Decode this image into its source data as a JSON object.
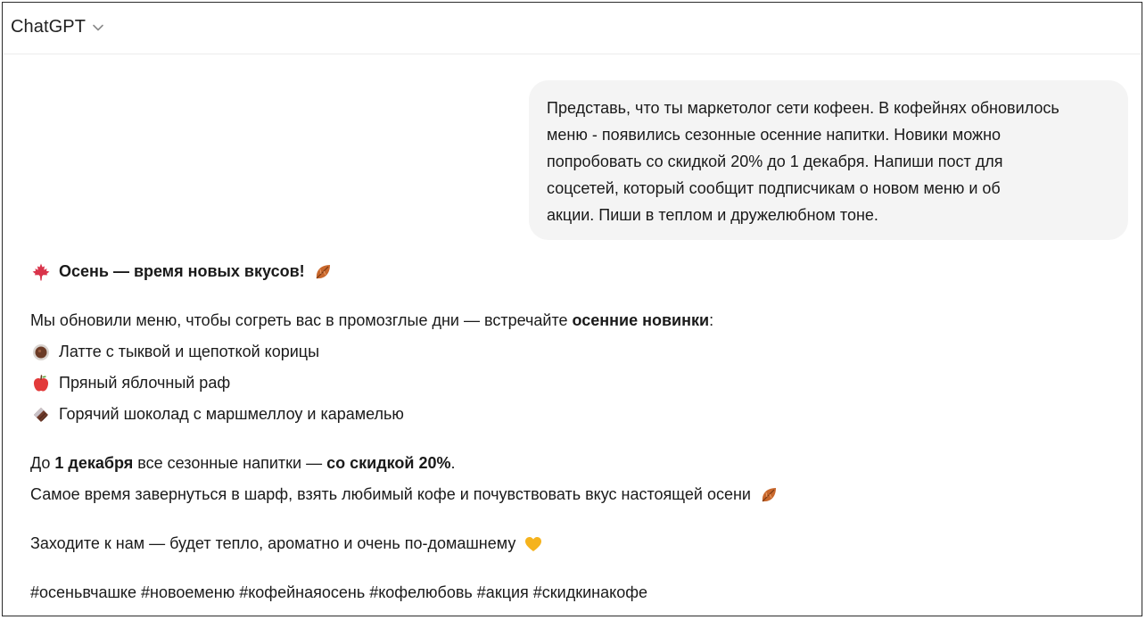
{
  "app": {
    "model_name": "ChatGPT"
  },
  "user_message": {
    "lines": [
      "Представь, что ты маркетолог сети кофеен. В кофейнях обновилось",
      "меню - появились сезонные осенние напитки. Новики можно",
      "попробовать со скидкой 20% до 1 декабря. Напиши пост для",
      "соцсетей, который сообщит подписчикам о новом меню и об",
      "акции. Пиши в теплом и дружелюбном тоне."
    ]
  },
  "assistant_message": {
    "title": "Осень — время новых вкусов!",
    "intro_prefix": "Мы обновили меню, чтобы согреть вас в промозглые дни — встречайте ",
    "intro_bold": "осенние новинки",
    "intro_suffix": ":",
    "items": [
      {
        "icon": "coffee-cup-icon",
        "text": "Латте с тыквой и щепоткой корицы"
      },
      {
        "icon": "apple-icon",
        "text": "Пряный яблочный раф"
      },
      {
        "icon": "chocolate-bar-icon",
        "text": "Горячий шоколад с маршмеллоу и карамелью"
      }
    ],
    "promo_prefix": "До ",
    "promo_date": "1 декабря",
    "promo_middle": " все сезонные напитки — ",
    "promo_discount": "со скидкой 20%",
    "promo_suffix": ".",
    "mood_line": "Самое время завернуться в шарф, взять любимый кофе и почувствовать вкус настоящей осени",
    "invite_line": "Заходите к нам — будет тепло, ароматно и очень по-домашнему",
    "hashtags": "#осеньвчашке #новоеменю #кофейнаяосень #кофелюбовь #акция #скидкинакофе"
  },
  "colors": {
    "bubble_bg": "#f4f4f4",
    "text": "#1a1a1a",
    "maple_leaf": "#d9344b",
    "fallen_leaf": "#c8672c",
    "yellow_heart": "#f5b31d"
  }
}
